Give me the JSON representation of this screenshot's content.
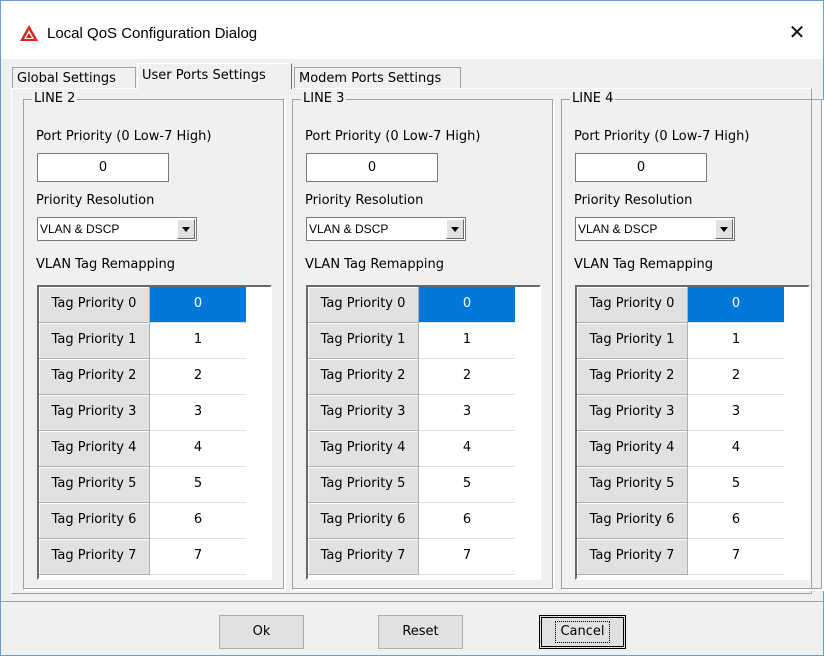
{
  "window": {
    "title": "Local QoS Configuration Dialog",
    "close_label": "✕"
  },
  "tabs": [
    {
      "label": "Global Settings",
      "active": false
    },
    {
      "label": "User Ports Settings",
      "active": true
    },
    {
      "label": "Modem Ports Settings",
      "active": false
    }
  ],
  "labels": {
    "port_priority": "Port Priority (0 Low-7 High)",
    "priority_resolution": "Priority Resolution",
    "vlan_tag_remapping": "VLAN Tag Remapping"
  },
  "lines": [
    {
      "name": "LINE 2",
      "port_priority": "0",
      "priority_resolution": "VLAN & DSCP",
      "remap": [
        {
          "tag": "Tag Priority 0",
          "value": "0"
        },
        {
          "tag": "Tag Priority 1",
          "value": "1"
        },
        {
          "tag": "Tag Priority 2",
          "value": "2"
        },
        {
          "tag": "Tag Priority 3",
          "value": "3"
        },
        {
          "tag": "Tag Priority 4",
          "value": "4"
        },
        {
          "tag": "Tag Priority 5",
          "value": "5"
        },
        {
          "tag": "Tag Priority 6",
          "value": "6"
        },
        {
          "tag": "Tag Priority 7",
          "value": "7"
        }
      ]
    },
    {
      "name": "LINE 3",
      "port_priority": "0",
      "priority_resolution": "VLAN & DSCP",
      "remap": [
        {
          "tag": "Tag Priority 0",
          "value": "0"
        },
        {
          "tag": "Tag Priority 1",
          "value": "1"
        },
        {
          "tag": "Tag Priority 2",
          "value": "2"
        },
        {
          "tag": "Tag Priority 3",
          "value": "3"
        },
        {
          "tag": "Tag Priority 4",
          "value": "4"
        },
        {
          "tag": "Tag Priority 5",
          "value": "5"
        },
        {
          "tag": "Tag Priority 6",
          "value": "6"
        },
        {
          "tag": "Tag Priority 7",
          "value": "7"
        }
      ]
    },
    {
      "name": "LINE 4",
      "port_priority": "0",
      "priority_resolution": "VLAN & DSCP",
      "remap": [
        {
          "tag": "Tag Priority 0",
          "value": "0"
        },
        {
          "tag": "Tag Priority 1",
          "value": "1"
        },
        {
          "tag": "Tag Priority 2",
          "value": "2"
        },
        {
          "tag": "Tag Priority 3",
          "value": "3"
        },
        {
          "tag": "Tag Priority 4",
          "value": "4"
        },
        {
          "tag": "Tag Priority 5",
          "value": "5"
        },
        {
          "tag": "Tag Priority 6",
          "value": "6"
        },
        {
          "tag": "Tag Priority 7",
          "value": "7"
        }
      ]
    }
  ],
  "buttons": {
    "ok": "Ok",
    "reset": "Reset",
    "cancel": "Cancel"
  },
  "colors": {
    "selection": "#0078d7",
    "brand_icon": "#e02020"
  },
  "icons": {
    "app": "warning-triangle-logo-icon",
    "close": "close-icon",
    "dropdown": "chevron-down-icon"
  }
}
